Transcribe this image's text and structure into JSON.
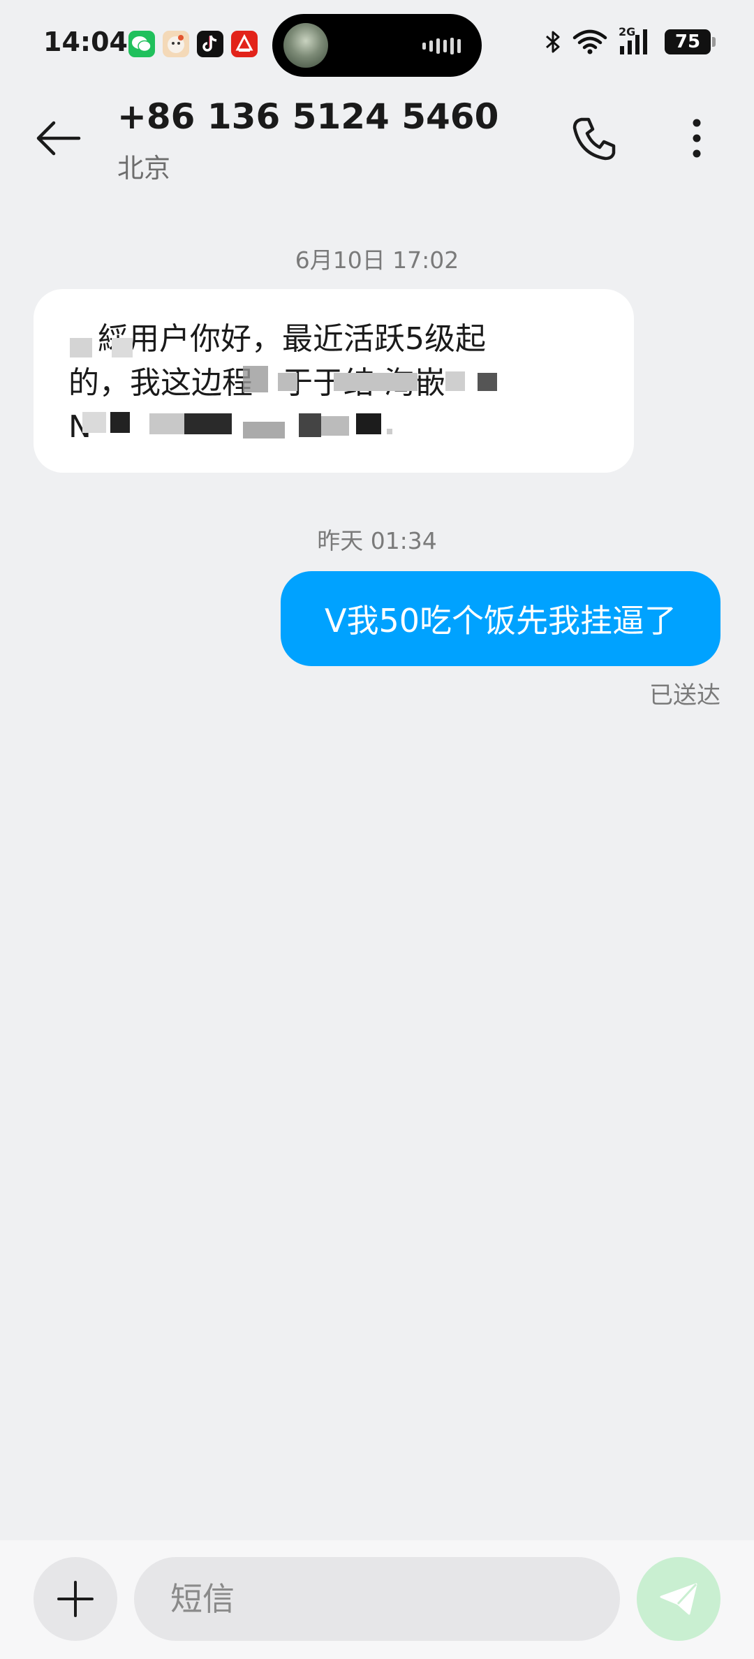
{
  "status_bar": {
    "time": "14:04",
    "battery": "75",
    "network_label": "2G"
  },
  "header": {
    "contact_number": "+86 136 5124 5460",
    "contact_location": "北京"
  },
  "messages": [
    {
      "direction": "incoming",
      "timestamp": "6月10日 17:02",
      "text": "   綵用户你好，最近活跃5级起\n的，我这边程   于于结 淘嵌\nN"
    },
    {
      "direction": "outgoing",
      "timestamp": "昨天 01:34",
      "text": "V我50吃个饭先我挂逼了",
      "status": "已送达"
    }
  ],
  "composer": {
    "placeholder": "短信"
  },
  "colors": {
    "outgoing_bubble": "#00a2ff",
    "incoming_bubble": "#ffffff",
    "background": "#eff0f2",
    "send_button": "#c9efd1"
  }
}
